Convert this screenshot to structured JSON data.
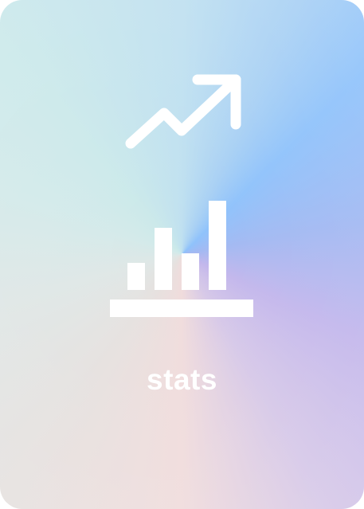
{
  "card": {
    "label": "stats",
    "icons": [
      "trending-up-icon",
      "bar-chart-icon"
    ],
    "icon_color": "#ffffff"
  }
}
